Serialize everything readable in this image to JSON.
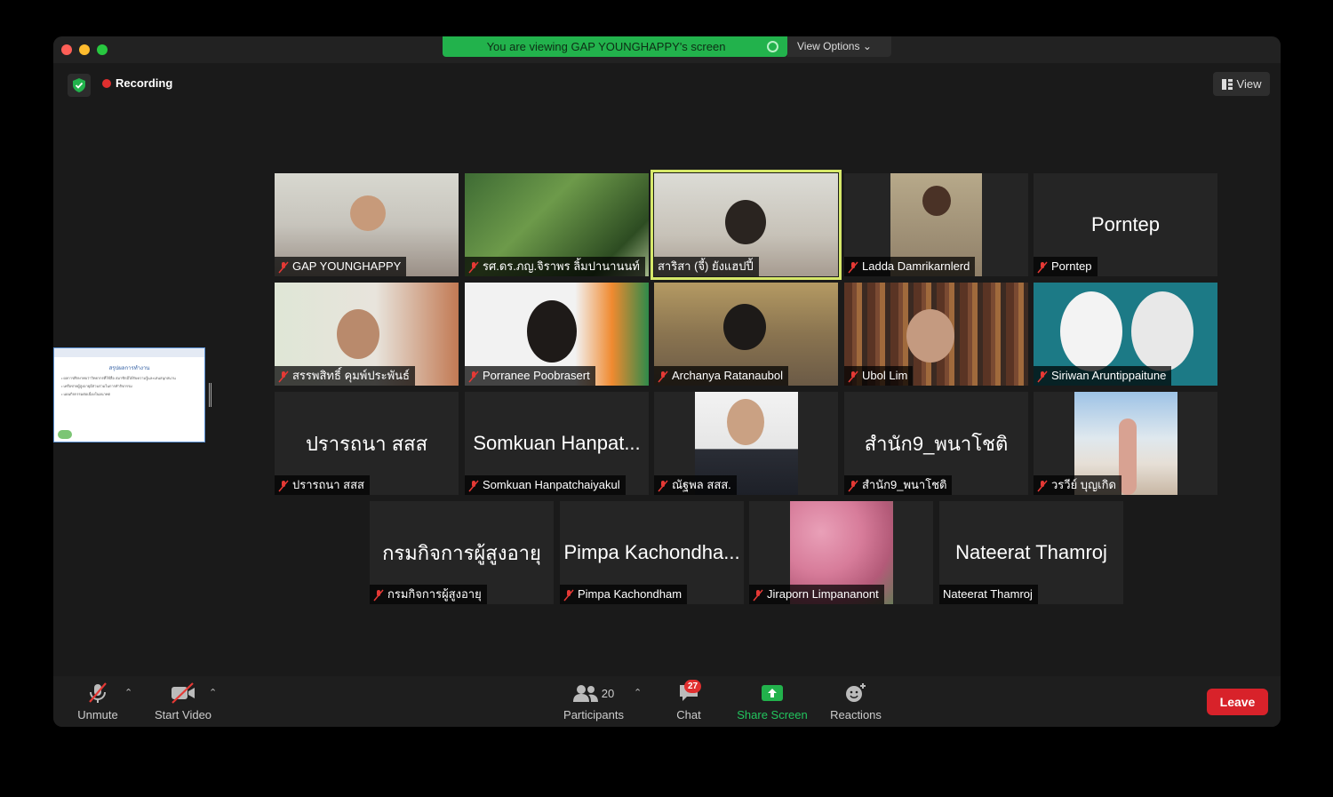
{
  "banner": {
    "text": "You are viewing GAP YOUNGHAPPY's screen",
    "view_options": "View Options"
  },
  "header": {
    "recording": "Recording",
    "view": "View"
  },
  "shared_screen": {
    "title": "สรุปผลการทำงาน",
    "lines": [
      "• ผลการศึกษาพบว่าวิทยากรที่ใช้สื่อ สมาชิกมีได้รับความรู้และเล่นสนุกสนาน",
      "• เครือข่ายผู้สูงอายุมีส่วนร่วมในการทำกิจกรรม",
      "• แผนกิจกรรมต่อเนื่องในอนาคต"
    ]
  },
  "participants": [
    {
      "name": "GAP YOUNGHAPPY",
      "big": "",
      "muted": true
    },
    {
      "name": "รศ.ดร.ภญ.จิราพร ลิ้มปานานนท์",
      "big": "",
      "muted": true
    },
    {
      "name": "สาริสา (จี้) ยังแฮปปี้",
      "big": "",
      "muted": false
    },
    {
      "name": "Ladda Damrikarnlerd",
      "big": "",
      "muted": true
    },
    {
      "name": "Porntep",
      "big": "Porntep",
      "muted": true
    },
    {
      "name": "สรรพสิทธิ์ คุมพ์ประพันธ์",
      "big": "",
      "muted": true
    },
    {
      "name": "Porranee Poobrasert",
      "big": "",
      "muted": true
    },
    {
      "name": "Archanya Ratanaubol",
      "big": "",
      "muted": true
    },
    {
      "name": "Ubol Lim",
      "big": "",
      "muted": true
    },
    {
      "name": "Siriwan Aruntippaitune",
      "big": "",
      "muted": true
    },
    {
      "name": "ปรารถนา สสส",
      "big": "ปรารถนา สสส",
      "muted": true
    },
    {
      "name": "Somkuan Hanpatchaiyakul",
      "big": "Somkuan Hanpat...",
      "muted": true
    },
    {
      "name": "ณัฐพล สสส.",
      "big": "",
      "muted": true
    },
    {
      "name": "สำนัก9_พนาโชติ",
      "big": "สำนัก9_พนาโชติ",
      "muted": true
    },
    {
      "name": "วรวีย์ บุญเกิด",
      "big": "",
      "muted": true
    },
    {
      "name": "กรมกิจการผู้สูงอายุ",
      "big": "กรมกิจการผู้สูงอายุ",
      "muted": true
    },
    {
      "name": "Pimpa Kachondham",
      "big": "Pimpa Kachondha...",
      "muted": true
    },
    {
      "name": "Jiraporn Limpananont",
      "big": "",
      "muted": true
    },
    {
      "name": "Nateerat  Thamroj",
      "big": "Nateerat  Thamroj",
      "muted": false
    }
  ],
  "toolbar": {
    "unmute": "Unmute",
    "start_video": "Start Video",
    "participants": "Participants",
    "participants_count": "20",
    "chat": "Chat",
    "chat_badge": "27",
    "share_screen": "Share Screen",
    "reactions": "Reactions",
    "leave": "Leave"
  },
  "colors": {
    "share_green": "#22b24c",
    "leave_red": "#d8222a",
    "active_outline": "#d6e86a"
  }
}
